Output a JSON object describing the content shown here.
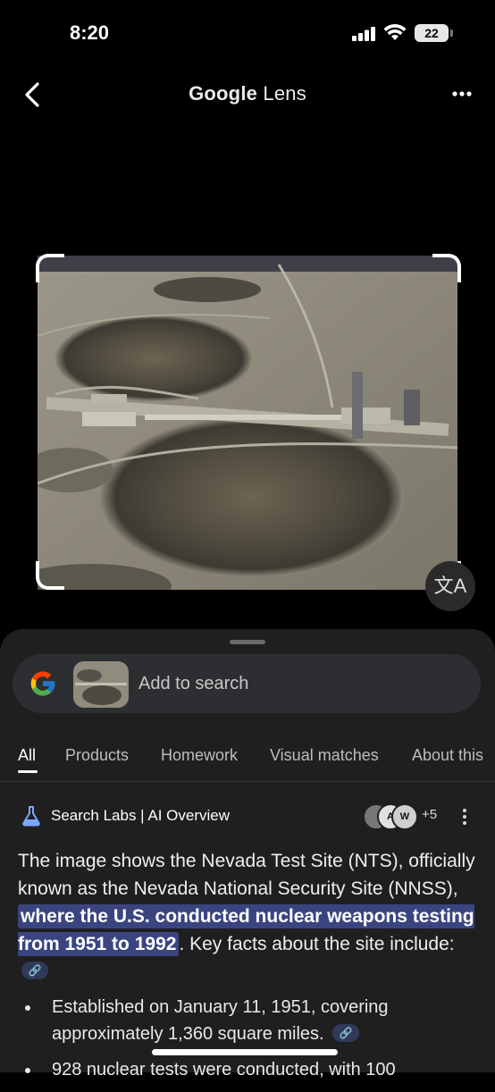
{
  "status": {
    "time": "8:20",
    "battery": "22"
  },
  "header": {
    "title_brand": "Google",
    "title_product": " Lens"
  },
  "search": {
    "placeholder": "Add to search"
  },
  "tabs": [
    {
      "label": "All"
    },
    {
      "label": "Products"
    },
    {
      "label": "Homework"
    },
    {
      "label": "Visual matches"
    },
    {
      "label": "About this"
    }
  ],
  "overview": {
    "source": "Search Labs | AI Overview",
    "sources_more": "+5",
    "text_before": "The image shows the Nevada Test Site (NTS), officially known as the Nevada National Security Site (NNSS), ",
    "text_highlight": "where the U.S. conducted nuclear weapons testing from 1951 to 1992",
    "text_after": ". Key facts about the site include:",
    "bullets": [
      {
        "text": "Established on January 11, 1951, covering approximately 1,360 square miles."
      },
      {
        "text": "928 nuclear tests were conducted, with 100"
      }
    ]
  },
  "icons": {
    "back": "chevron-left-icon",
    "more": "more-horizontal-icon",
    "translate": "translate-icon",
    "labs": "flask-icon",
    "kebab": "more-vertical-icon",
    "link": "link-icon"
  },
  "colors": {
    "highlight": "#3a4580",
    "sheet": "#1f1f1f"
  }
}
